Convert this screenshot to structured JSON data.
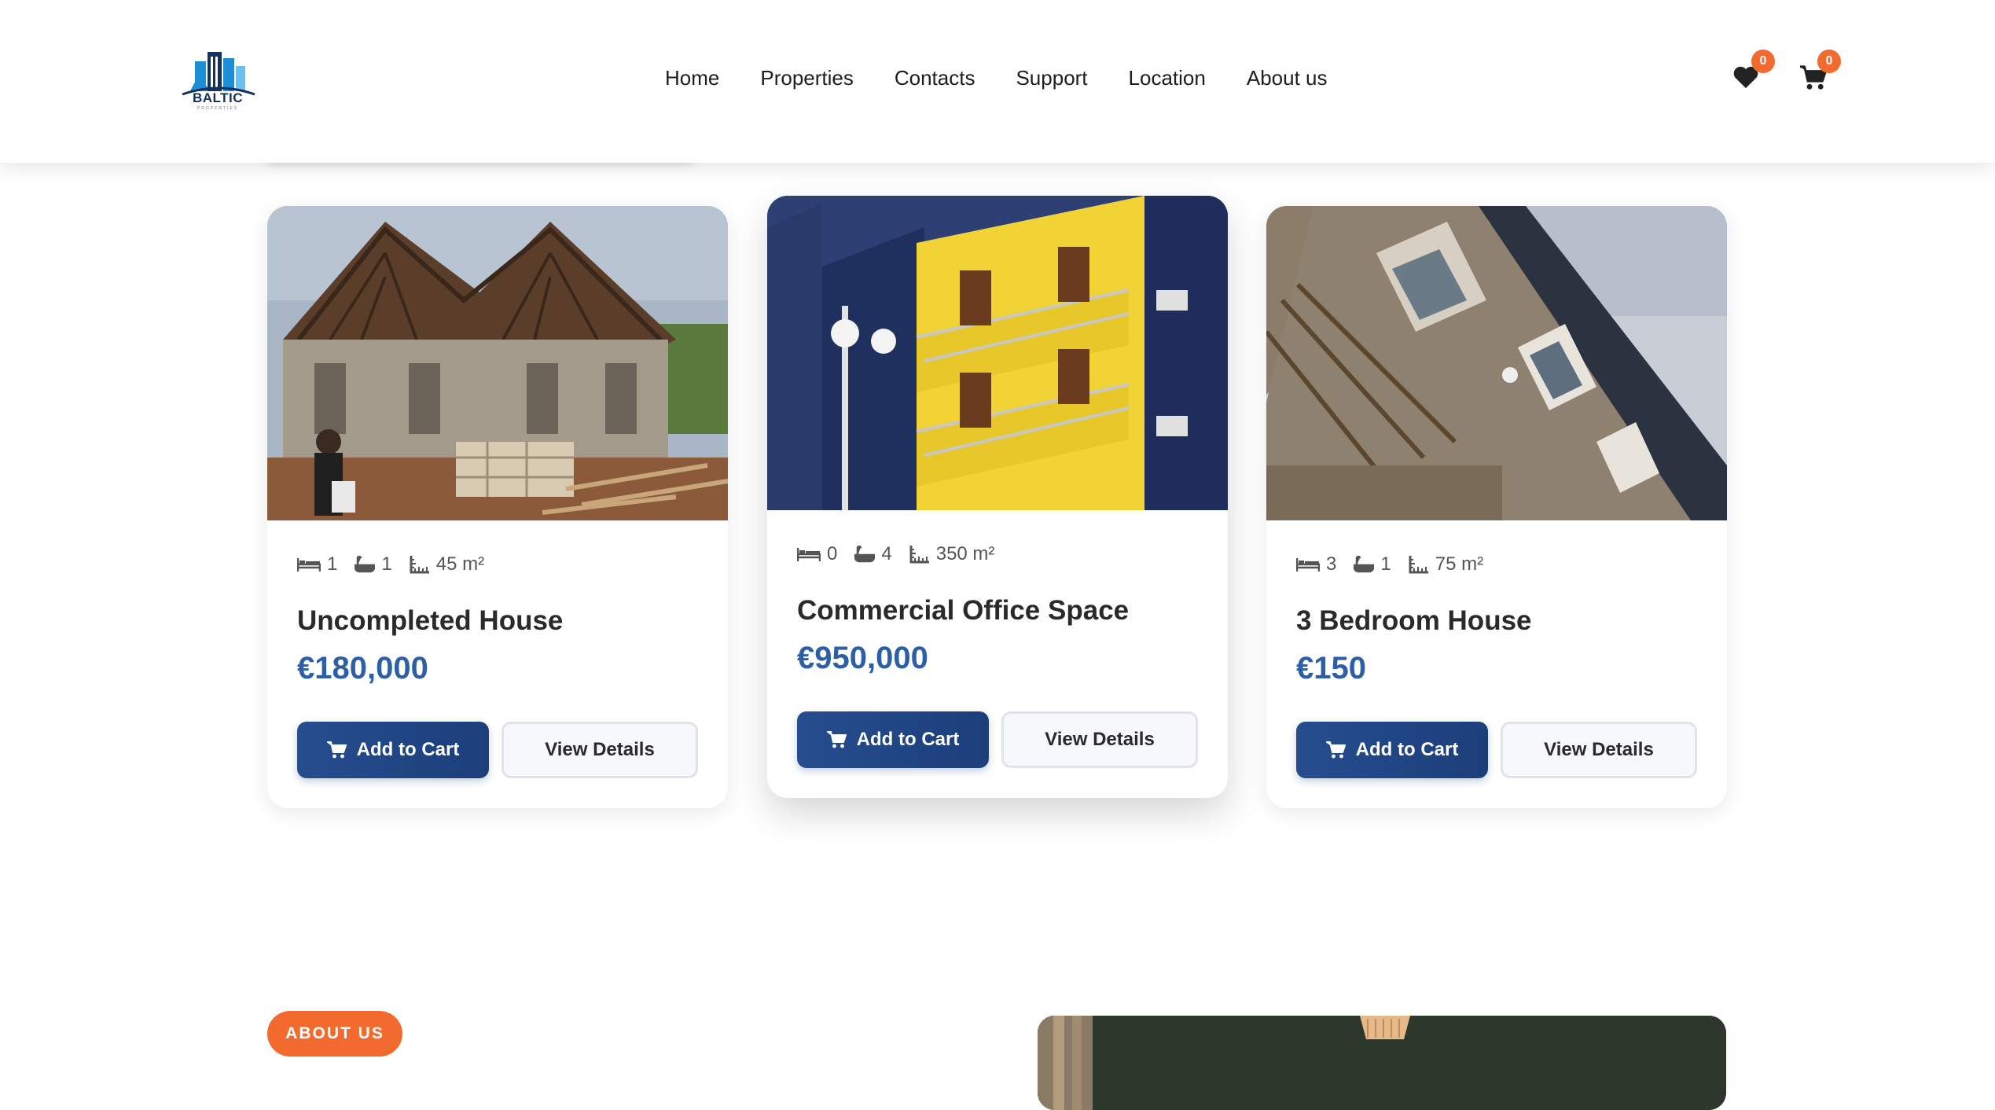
{
  "header": {
    "logo_text": "BALTIC",
    "logo_subtext": "PROPERTIES",
    "nav": [
      "Home",
      "Properties",
      "Contacts",
      "Support",
      "Location",
      "About us"
    ],
    "wishlist_count": "0",
    "cart_count": "0"
  },
  "properties": [
    {
      "beds": "1",
      "baths": "1",
      "area": "45 m²",
      "title": "Uncompleted House",
      "price": "€180,000",
      "cart_label": "Add to Cart",
      "details_label": "View Details"
    },
    {
      "beds": "0",
      "baths": "4",
      "area": "350 m²",
      "title": "Commercial Office Space",
      "price": "€950,000",
      "cart_label": "Add to Cart",
      "details_label": "View Details"
    },
    {
      "beds": "3",
      "baths": "1",
      "area": "75 m²",
      "title": "3 Bedroom House",
      "price": "€150",
      "cart_label": "Add to Cart",
      "details_label": "View Details"
    }
  ],
  "about": {
    "badge": "ABOUT US"
  },
  "colors": {
    "brand": "#1c3f7a",
    "price": "#2c5fa8",
    "accent": "#f26a2e"
  }
}
